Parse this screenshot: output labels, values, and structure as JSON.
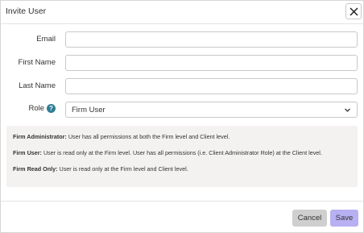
{
  "dialog": {
    "title": "Invite User",
    "close_icon": "close-icon"
  },
  "form": {
    "email": {
      "label": "Email",
      "value": "",
      "placeholder": ""
    },
    "first_name": {
      "label": "First Name",
      "value": "",
      "placeholder": ""
    },
    "last_name": {
      "label": "Last Name",
      "value": "",
      "placeholder": ""
    },
    "role": {
      "label": "Role",
      "help_icon": "help-icon",
      "help_glyph": "?",
      "selected": "Firm User",
      "chevron_icon": "chevron-down-icon"
    }
  },
  "info": {
    "items": [
      {
        "term": "Firm Administrator:",
        "desc": " User has all permissions at both the Firm level and Client level."
      },
      {
        "term": "Firm User:",
        "desc": " User is read only at the Firm level. User has all permissions (i.e. Client Administrator Role) at the Client level."
      },
      {
        "term": "Firm Read Only:",
        "desc": " User is read only at the Firm level and Client level."
      }
    ]
  },
  "footer": {
    "cancel_label": "Cancel",
    "save_label": "Save"
  },
  "colors": {
    "save_button": "#b7b0f2",
    "cancel_button": "#cfcfcf",
    "help_icon": "#2f7d95",
    "info_background": "#f4f2f1"
  }
}
